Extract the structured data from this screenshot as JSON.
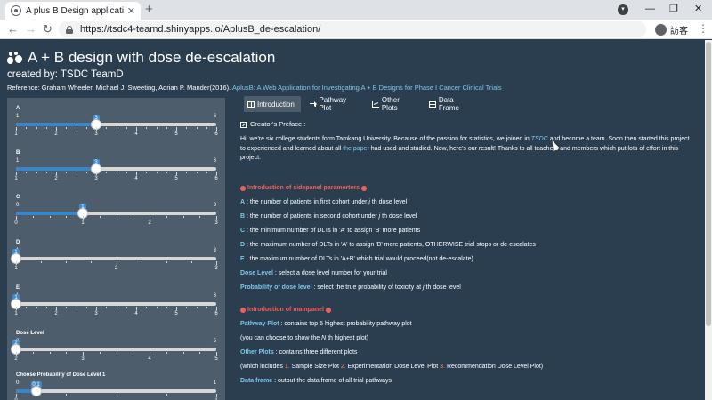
{
  "browser": {
    "tab_title": "A plus B Design application with dose de-escalation",
    "tab_close": "✕",
    "new_tab": "+",
    "url": "https://tsdc4-teamd.shinyapps.io/AplusB_de-escalation/",
    "profile_name": "訪客",
    "back": "←",
    "forward": "→",
    "reload": "↻",
    "tab_search": "▾",
    "minimize": "—",
    "restore": "❐",
    "close": "✕",
    "menu": "⋮"
  },
  "header": {
    "title": "A + B design with dose de-escalation",
    "subtitle": "created by: TSDC TeamD",
    "reference_prefix": "Reference: Graham Wheeler, Michael J. Sweeting, Adrian P. Mander(2016).",
    "reference_link": "AplusB: A Web Application for Investigating A + B Designs for Phase I Cancer Clinical Trials"
  },
  "sliders": [
    {
      "label": "A",
      "min": "1",
      "max": "6",
      "value": "3",
      "fraction": 0.4,
      "ticks": [
        "1",
        "2",
        "3",
        "4",
        "5",
        "6"
      ]
    },
    {
      "label": "B",
      "min": "1",
      "max": "6",
      "value": "3",
      "fraction": 0.4,
      "ticks": [
        "1",
        "2",
        "3",
        "4",
        "5",
        "6"
      ]
    },
    {
      "label": "C",
      "min": "0",
      "max": "3",
      "value": "1",
      "fraction": 0.333,
      "ticks": [
        "0",
        "1",
        "2",
        "3"
      ]
    },
    {
      "label": "D",
      "min": "1",
      "max": "3",
      "value": "1",
      "fraction": 0.0,
      "ticks": [
        "1",
        "2",
        "3"
      ]
    },
    {
      "label": "E",
      "min": "1",
      "max": "6",
      "value": "1",
      "fraction": 0.0,
      "ticks": [
        "1",
        "2",
        "3",
        "4",
        "5",
        "6"
      ]
    },
    {
      "label": "Dose Level",
      "min": "2",
      "max": "5",
      "value": "2",
      "fraction": 0.0,
      "ticks": [
        "2",
        "3",
        "4",
        "5"
      ]
    },
    {
      "label": "Choose Probability of Dose Level 1",
      "min": "0",
      "max": "1",
      "value": "0.1",
      "fraction": 0.1,
      "ticks": [
        "0",
        "1"
      ]
    }
  ],
  "tabs": [
    {
      "label": "Introduction",
      "icon": "book-icon",
      "active": true
    },
    {
      "label": "Pathway Plot",
      "icon": "share-icon",
      "active": false
    },
    {
      "label": "Other Plots",
      "icon": "chart-icon",
      "active": false
    },
    {
      "label": "Data Frame",
      "icon": "table-icon",
      "active": false
    }
  ],
  "content": {
    "preface_heading": "Creator's Preface :",
    "intro_1": "Hi, we're six college students form Tamkang University. Because of the passion for statistics, we joined in ",
    "intro_tsdc": "TSDC",
    "intro_2": " and become a team. Soon then started this project to experienced and learned about all ",
    "intro_paper": "the paper",
    "intro_3": " had used and studied. Now, here's our result! Thanks to all teachers and members which put lots of effort in this project.",
    "sidepanel_heading": "Introduction of sidepanel paramerters",
    "params": [
      {
        "key": "A",
        "text": " : the number of patients in first cohort under ",
        "ital": "j",
        "tail": " th dose level"
      },
      {
        "key": "B",
        "text": " : the number of patients in second cohort under ",
        "ital": "j",
        "tail": " th dose level"
      },
      {
        "key": "C",
        "text": " : the minimum number of DLTs in 'A' to assign 'B' more patients",
        "ital": "",
        "tail": ""
      },
      {
        "key": "D",
        "text": " : the maximum number of DLTs in 'A' to assign 'B' more patients, OTHERWISE trial stops or de-escalates",
        "ital": "",
        "tail": ""
      },
      {
        "key": "E",
        "text": " : the maximum number of DLTs in 'A+B' which trial would proceed(not de-escalate)",
        "ital": "",
        "tail": ""
      },
      {
        "key": "Dose Level",
        "text": " : select a dose level number for your trial",
        "ital": "",
        "tail": ""
      },
      {
        "key": "Probability of dose level",
        "text": " : select the true probability of toxicity at ",
        "ital": "j",
        "tail": " th dose level"
      }
    ],
    "mainpanel_heading": "Introduction of mainpanel",
    "pathway_key": "Pathway Plot",
    "pathway_text": " : contains top 5 highest probability pathway plot",
    "pathway_note_1": "(you can choose to show the ",
    "pathway_note_ital": "N",
    "pathway_note_2": " th highest plot)",
    "other_key": "Other Plots",
    "other_text": " : contains three different plots",
    "other_note_1": "(which includes ",
    "other_n1": "1.",
    "other_p1": " Sample Size Plot ",
    "other_n2": "2.",
    "other_p2": " Experimentation Dose Level Plot ",
    "other_n3": "3.",
    "other_p3": " Recommendation Dose Level Plot)",
    "frame_key": "Data frame",
    "frame_text": " : output the data frame of all trial pathways"
  },
  "colors": {
    "background": "#2b3e50",
    "sidebar": "#4e5d6c",
    "accent_blue": "#3a85c6",
    "link": "#7bc8e8",
    "heading_red": "#f0605a"
  }
}
